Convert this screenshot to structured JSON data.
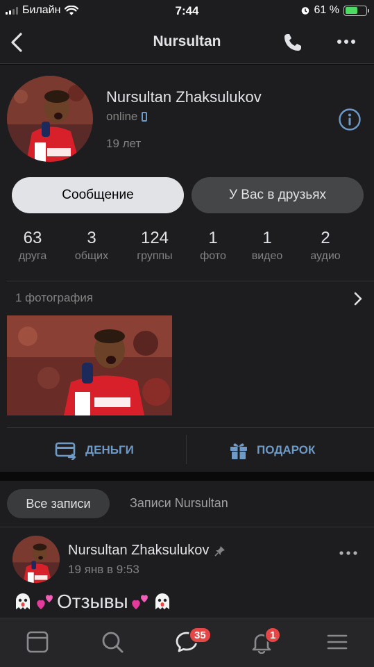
{
  "status_bar": {
    "carrier": "Билайн",
    "time": "7:44",
    "battery_pct": "61 %",
    "battery_level": 0.61
  },
  "nav": {
    "title": "Nursultan"
  },
  "profile": {
    "name": "Nursultan Zhaksulukov",
    "status": "online",
    "age": "19 лет",
    "message_button": "Сообщение",
    "friends_button": "У Вас в друзьях",
    "counters": [
      {
        "value": "63",
        "label": "друга"
      },
      {
        "value": "3",
        "label": "общих"
      },
      {
        "value": "124",
        "label": "группы"
      },
      {
        "value": "1",
        "label": "фото"
      },
      {
        "value": "1",
        "label": "видео"
      },
      {
        "value": "2",
        "label": "аудио"
      }
    ],
    "photos_header": "1 фотография",
    "actions": {
      "money": "ДЕНЬГИ",
      "gift": "ПОДАРОК"
    }
  },
  "feed": {
    "tabs": {
      "all": "Все записи",
      "user": "Записи Nursultan"
    },
    "post": {
      "author": "Nursultan Zhaksulukov",
      "date": "19 янв в 9:53",
      "text": "Отзывы"
    }
  },
  "tabbar": {
    "messages_badge": "35",
    "notifications_badge": "1"
  },
  "colors": {
    "accent": "#6d9ac7",
    "badge": "#e64646",
    "background": "#1d1d1f",
    "online_battery": "#4cd964"
  },
  "icons": [
    "back-icon",
    "phone-icon",
    "more-icon",
    "info-icon",
    "chevron-right-icon",
    "money-icon",
    "gift-icon",
    "pin-icon",
    "ghost-emoji",
    "hearts-emoji",
    "news-icon",
    "search-icon",
    "messages-icon",
    "bell-icon",
    "menu-icon"
  ]
}
